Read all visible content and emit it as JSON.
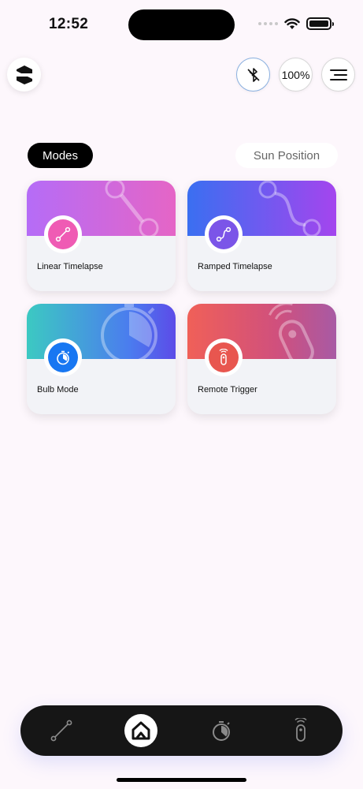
{
  "status_bar": {
    "time": "12:52"
  },
  "header": {
    "battery_label": "100%"
  },
  "tabs": [
    {
      "label": "Modes",
      "active": true
    },
    {
      "label": "Sun Position",
      "active": false
    }
  ],
  "modes": [
    {
      "label": "Linear Timelapse",
      "icon": "linear-path-icon",
      "accent": "#ef5bb4"
    },
    {
      "label": "Ramped Timelapse",
      "icon": "ramped-curve-icon",
      "accent": "#7b55e8"
    },
    {
      "label": "Bulb Mode",
      "icon": "stopwatch-icon",
      "accent": "#1877f2"
    },
    {
      "label": "Remote Trigger",
      "icon": "remote-icon",
      "accent": "#e8564f"
    }
  ],
  "bottom_nav": {
    "items": [
      "linear-timelapse-icon",
      "home-icon",
      "stopwatch-icon",
      "remote-icon"
    ],
    "active": "home-icon"
  }
}
